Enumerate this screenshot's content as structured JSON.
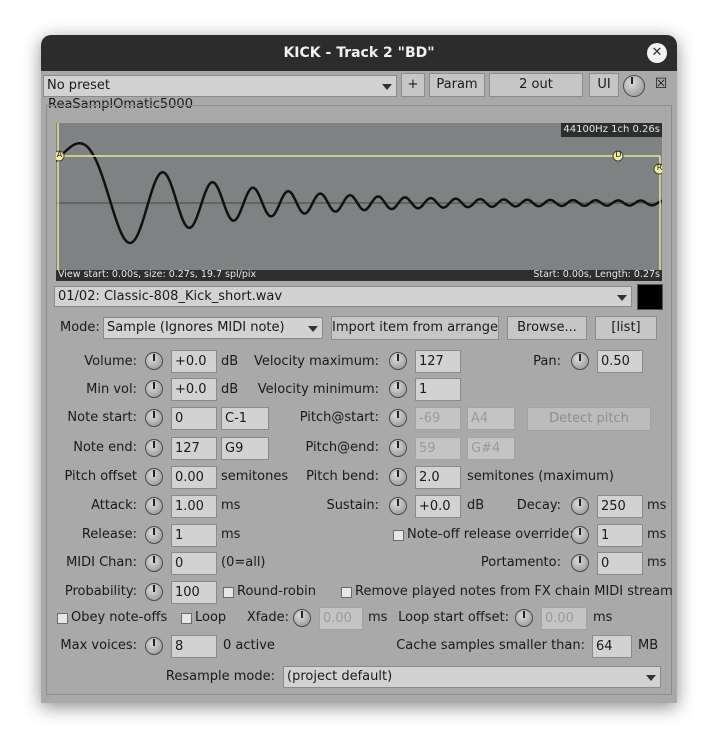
{
  "window": {
    "title": "KICK - Track 2 \"BD\""
  },
  "toolbar": {
    "preset": "No preset",
    "add_label": "+",
    "param_label": "Param",
    "out_label": "2 out",
    "ui_label": "UI",
    "close_x": "☒"
  },
  "plugin_name": "ReaSamplOmatic5000",
  "waveform": {
    "info_top": "44100Hz 1ch 0.26s",
    "info_bottom_left": "View start: 0.00s, size: 0.27s, 19.7 spl/pix",
    "info_bottom_right": "Start: 0.00s, Length: 0.27s",
    "marker_a": "A",
    "marker_d": "D",
    "marker_r": "R"
  },
  "file": "01/02: Classic-808_Kick_short.wav",
  "mode": {
    "label": "Mode:",
    "value": "Sample (Ignores MIDI note)",
    "import_label": "Import item from arrange",
    "browse_label": "Browse...",
    "list_label": "[list]"
  },
  "params": {
    "volume": {
      "label": "Volume:",
      "value": "+0.0",
      "unit": "dB"
    },
    "velmax": {
      "label": "Velocity maximum:",
      "value": "127"
    },
    "pan": {
      "label": "Pan:",
      "value": "0.50"
    },
    "minvol": {
      "label": "Min vol:",
      "value": "+0.0",
      "unit": "dB"
    },
    "velmin": {
      "label": "Velocity minimum:",
      "value": "1"
    },
    "notestart": {
      "label": "Note start:",
      "value": "0",
      "note": "C-1"
    },
    "pitchstart": {
      "label": "Pitch@start:",
      "value": "-69",
      "note": "A4"
    },
    "detect_label": "Detect pitch",
    "noteend": {
      "label": "Note end:",
      "value": "127",
      "note": "G9"
    },
    "pitchend": {
      "label": "Pitch@end:",
      "value": "59",
      "note": "G#4"
    },
    "pitchoffset": {
      "label": "Pitch offset",
      "value": "0.00",
      "unit": "semitones"
    },
    "pitchbend": {
      "label": "Pitch bend:",
      "value": "2.0",
      "unit": "semitones (maximum)"
    },
    "attack": {
      "label": "Attack:",
      "value": "1.00",
      "unit": "ms"
    },
    "sustain": {
      "label": "Sustain:",
      "value": "+0.0",
      "unit": "dB"
    },
    "decay": {
      "label": "Decay:",
      "value": "250",
      "unit": "ms"
    },
    "release": {
      "label": "Release:",
      "value": "1",
      "unit": "ms"
    },
    "noteoff_override": {
      "label": "Note-off release override:",
      "value": "1",
      "unit": "ms"
    },
    "midichan": {
      "label": "MIDI Chan:",
      "value": "0",
      "unit": "(0=all)"
    },
    "portamento": {
      "label": "Portamento:",
      "value": "0",
      "unit": "ms"
    },
    "probability": {
      "label": "Probability:",
      "value": "100"
    },
    "roundrobin_label": "Round-robin",
    "remove_label": "Remove played notes from FX chain MIDI stream",
    "obey_label": "Obey note-offs",
    "loop_label": "Loop",
    "xfade": {
      "label": "Xfade:",
      "value": "0.00",
      "unit": "ms"
    },
    "loopstart": {
      "label": "Loop start offset:",
      "value": "0.00",
      "unit": "ms"
    },
    "maxvoices": {
      "label": "Max voices:",
      "value": "8",
      "status": "0 active"
    },
    "cache": {
      "label": "Cache samples smaller than:",
      "value": "64",
      "unit": "MB"
    },
    "resample": {
      "label": "Resample mode:",
      "value": "(project default)"
    }
  }
}
